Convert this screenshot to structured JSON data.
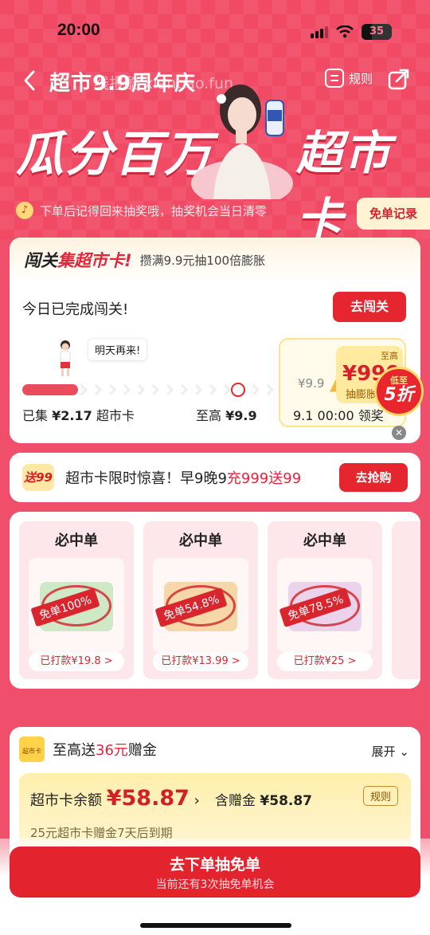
{
  "status": {
    "time": "20:00",
    "battery": "35",
    "battery_fraction": 0.35
  },
  "header": {
    "title": "超市9.9周年庆",
    "watermark": "线报酷 xianbao.fun",
    "rules_label": "规则"
  },
  "hero": {
    "left_text": "瓜分百万",
    "right_text": "超市卡"
  },
  "tip": {
    "text": "下单后记得回来抽奖哦，抽奖机会当日清零",
    "record_button": "免单记录"
  },
  "challenge": {
    "title_prefix": "闯关",
    "title_highlight": "集超市卡!",
    "subtitle": "攒满9.9元抽100倍膨胀",
    "done_text": "今日已完成闯关!",
    "go_button": "去闯关",
    "bubble": "明天再来!",
    "progress_fraction": 0.22,
    "collected_label": "已集",
    "collected_value": "¥2.17",
    "collected_unit": "超市卡",
    "max_label": "至高",
    "max_value": "¥9.9",
    "prize_old": "¥9.9",
    "prize_hi_label": "至高",
    "prize_hi_value": "¥990",
    "prize_hi_sub": "抽膨胀",
    "prize_date": "9.1 00:00 领奖",
    "discount_top": "低至",
    "discount_bottom": "5折"
  },
  "promo": {
    "badge": "送99",
    "text_prefix": "超市卡限时惊喜！早9晚9",
    "text_highlight": "充999送99",
    "button": "去抢购"
  },
  "free_orders": [
    {
      "title": "必中单",
      "stamp": "免单100%",
      "paid": "已打款¥19.8 >",
      "color": "#cfe8c6"
    },
    {
      "title": "必中单",
      "stamp": "免单54.8%",
      "paid": "已打款¥13.99 >",
      "color": "#f6d8a8"
    },
    {
      "title": "必中单",
      "stamp": "免单78.5%",
      "paid": "已打款¥25 >",
      "color": "#ecd3ec"
    }
  ],
  "bonus": {
    "icon_text": "超市卡",
    "title_prefix": "至高送",
    "title_highlight": "36元",
    "title_suffix": "赠金",
    "expand": "展开",
    "balance_label": "超市卡余额",
    "balance_value": "¥58.87",
    "gift_label": "含赠金",
    "gift_value": "¥58.87",
    "rule": "规则",
    "expire_text": "25元超市卡赠金7天后到期"
  },
  "cta": {
    "main": "去下单抽免单",
    "sub": "当前还有3次抽免单机会"
  }
}
